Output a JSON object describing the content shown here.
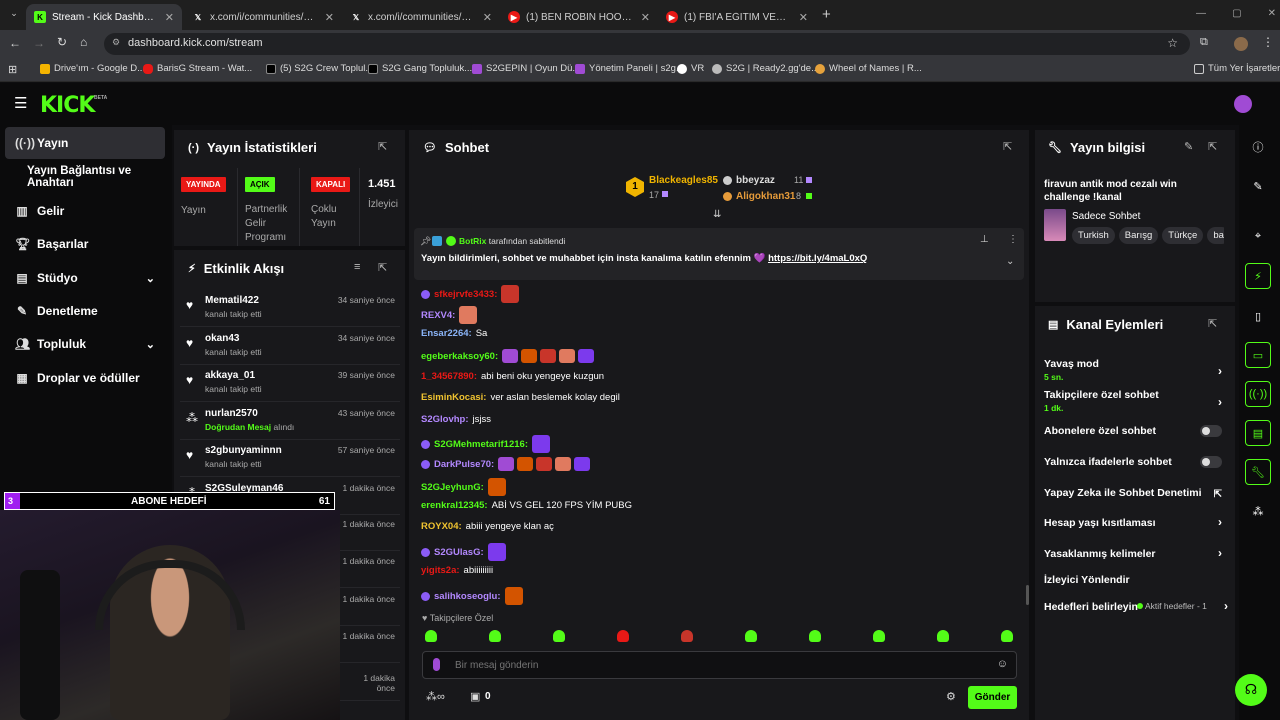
{
  "browser": {
    "tabs": [
      {
        "title": "Stream - Kick Dashboard",
        "icon": "kick-icon",
        "active": true
      },
      {
        "title": "x.com/i/communities/1960386...",
        "icon": "x-icon"
      },
      {
        "title": "x.com/i/communities/1835319...",
        "icon": "x-icon"
      },
      {
        "title": "(1) BEN ROBIN HOOD | Madara",
        "icon": "youtube-icon"
      },
      {
        "title": "(1) FBI'A EĞİTİM VEREN SERİ KA",
        "icon": "youtube-icon"
      }
    ],
    "new_tab": "+",
    "url": "dashboard.kick.com/stream",
    "bookmarks": [
      "Drive'ım - Google D...",
      "BarisG Stream - Wat...",
      "(5) S2G Crew Toplul...",
      "S2G Gang Topluluk...",
      "S2GEPIN | Oyun Dü...",
      "Yönetim Paneli | s2g...",
      "VR",
      "S2G | Ready2.gg'de...",
      "Wheel of Names | R..."
    ],
    "all_bookmarks": "Tüm Yer İşaretleri"
  },
  "kick": {
    "logo": "KICK",
    "beta": "BETA",
    "accent": "#53fc18"
  },
  "sidebar": {
    "items": [
      {
        "label": "Yayın",
        "icon": "broadcast-icon",
        "active": true
      },
      {
        "label": "Yayın Bağlantısı ve Anahtarı",
        "icon": ""
      },
      {
        "label": "Gelir",
        "icon": "revenue-icon"
      },
      {
        "label": "Başarılar",
        "icon": "trophy-icon"
      },
      {
        "label": "Stüdyo",
        "icon": "studio-icon",
        "expand": true
      },
      {
        "label": "Denetleme",
        "icon": "moderation-icon"
      },
      {
        "label": "Topluluk",
        "icon": "community-icon",
        "expand": true
      },
      {
        "label": "Droplar ve ödüller",
        "icon": "drops-icon"
      }
    ]
  },
  "stats": {
    "title": "Yayın İstatistikleri",
    "items": [
      {
        "badge": "YAYINDA",
        "badge_color": "#e91916",
        "label": "Yayın"
      },
      {
        "badge": "AÇIK",
        "badge_color": "#53fc18",
        "label": "Partnerlik Gelir Programı"
      },
      {
        "badge": "KAPALI",
        "badge_color": "#e91916",
        "label": "Çoklu Yayın"
      },
      {
        "badge": "1.451",
        "label": "İzleyici"
      }
    ]
  },
  "activity": {
    "title": "Etkinlik Akışı",
    "items": [
      {
        "user": "Mematil422",
        "desc": "kanalı takip etti",
        "time": "34 saniye önce",
        "icon": "heart-icon"
      },
      {
        "user": "okan43",
        "desc": "kanalı takip etti",
        "time": "34 saniye önce",
        "icon": "heart-icon"
      },
      {
        "user": "akkaya_01",
        "desc": "kanalı takip etti",
        "time": "39 saniye önce",
        "icon": "heart-icon"
      },
      {
        "user": "nurlan2570",
        "desc_hl": "Doğrudan Mesaj",
        "desc": "alındı",
        "time": "43 saniye önce",
        "icon": "dm-icon"
      },
      {
        "user": "s2gbunyaminnn",
        "desc": "kanalı takip etti",
        "time": "57 saniye önce",
        "icon": "heart-icon"
      },
      {
        "user": "S2GSuleyman46",
        "desc_hl": "Doğrudan Mesaj",
        "desc": "alındı",
        "time": "1 dakika önce",
        "icon": "dm-icon"
      },
      {
        "user": "",
        "desc": "",
        "time": "1 dakika önce",
        "icon": ""
      },
      {
        "user": "",
        "desc": "",
        "time": "1 dakika önce",
        "icon": ""
      },
      {
        "user": "",
        "desc": "",
        "time": "1 dakika önce",
        "icon": ""
      },
      {
        "user": "",
        "desc": "",
        "time": "1 dakika önce",
        "icon": ""
      },
      {
        "user": "",
        "desc": "",
        "time": "1 dakika önce",
        "icon": ""
      }
    ]
  },
  "overlay": {
    "goal_left": "3",
    "goal_label": "ABONE HEDEFİ",
    "goal_right": "61"
  },
  "chat": {
    "title": "Sohbet",
    "leaders": [
      {
        "rank": "1",
        "name": "Blackeagles85",
        "count": "17"
      },
      {
        "name": "bbeyzaz",
        "count": "11"
      },
      {
        "name": "Aligokhan31",
        "count": "8"
      }
    ],
    "pinned": {
      "by_user": "BotRix",
      "by_suffix": "tarafından sabitlendi",
      "text": "Yayın bildirimleri, sohbet ve muhabbet için insta kanalıma katılın efennim 💜",
      "link": "https://bit.ly/4maL0xQ"
    },
    "messages": [
      {
        "user": "sfkejrvfe3433:",
        "color": "#e91916",
        "text": "",
        "emotes": 1
      },
      {
        "user": "REXV4:",
        "color": "#b388ff",
        "text": "",
        "emotes": 1
      },
      {
        "user": "Ensar2264:",
        "color": "#8ab4f8",
        "text": "Sa",
        "emotes": 0
      },
      {
        "user": "egeberkaksoy60:",
        "color": "#53fc18",
        "text": "",
        "emotes": 5
      },
      {
        "user": "1_34567890:",
        "color": "#e91916",
        "text": "abi beni oku yengeye kuzgun",
        "emotes": 0
      },
      {
        "user": "EsiminKocasi:",
        "color": "#f0c330",
        "text": "ver aslan beslemek kolay degil",
        "emotes": 0
      },
      {
        "user": "S2Glovhp:",
        "color": "#b388ff",
        "text": "jsjss",
        "emotes": 0
      },
      {
        "user": "S2GMehmetarif1216:",
        "color": "#53fc18",
        "text": "",
        "emotes": 1
      },
      {
        "user": "DarkPulse70:",
        "color": "#b388ff",
        "text": "",
        "emotes": 5
      },
      {
        "user": "S2GJeyhunG:",
        "color": "#53fc18",
        "text": "",
        "emotes": 1
      },
      {
        "user": "erenkral12345:",
        "color": "#53fc18",
        "text": "ABİ VS GEL 120 FPS YİM PUBG",
        "emotes": 0
      },
      {
        "user": "ROYX04:",
        "color": "#f0c330",
        "text": "abiii yengeye klan aç",
        "emotes": 0
      },
      {
        "user": "S2GUlasG:",
        "color": "#b388ff",
        "text": "",
        "emotes": 1
      },
      {
        "user": "yigits2a:",
        "color": "#e91916",
        "text": "abiiiiiiiii",
        "emotes": 0
      },
      {
        "user": "salihkoseoglu:",
        "color": "#b388ff",
        "text": "",
        "emotes": 1
      }
    ],
    "followers_only": "Takipçilere Özel",
    "input_placeholder": "Bir mesaj gönderin",
    "points": "0",
    "send_label": "Gönder"
  },
  "stream_info": {
    "title": "Yayın bilgisi",
    "stream_title": "firavun antik mod cezalı win challenge !kanal",
    "category": "Sadece Sohbet",
    "tags": [
      "Turkish",
      "Barışg",
      "Türkçe",
      "ba"
    ]
  },
  "channel_actions": {
    "title": "Kanal Eylemleri",
    "items": [
      {
        "label": "Yavaş mod",
        "sub": "5 sn.",
        "type": "chevron"
      },
      {
        "label": "Takipçilere özel sohbet",
        "sub": "1 dk.",
        "type": "chevron"
      },
      {
        "label": "Abonelere özel sohbet",
        "type": "toggle"
      },
      {
        "label": "Yalnızca ifadelerle sohbet",
        "type": "toggle"
      },
      {
        "label": "Yapay Zeka ile Sohbet Denetimi",
        "type": "external"
      },
      {
        "label": "Hesap yaşı kısıtlaması",
        "type": "chevron"
      },
      {
        "label": "Yasaklanmış kelimeler",
        "type": "chevron"
      },
      {
        "label": "İzleyici Yönlendir",
        "type": "none"
      },
      {
        "label": "Hedefleri belirleyin",
        "sub_inline": "Aktif hedefler - 1",
        "type": "chevron"
      }
    ]
  }
}
